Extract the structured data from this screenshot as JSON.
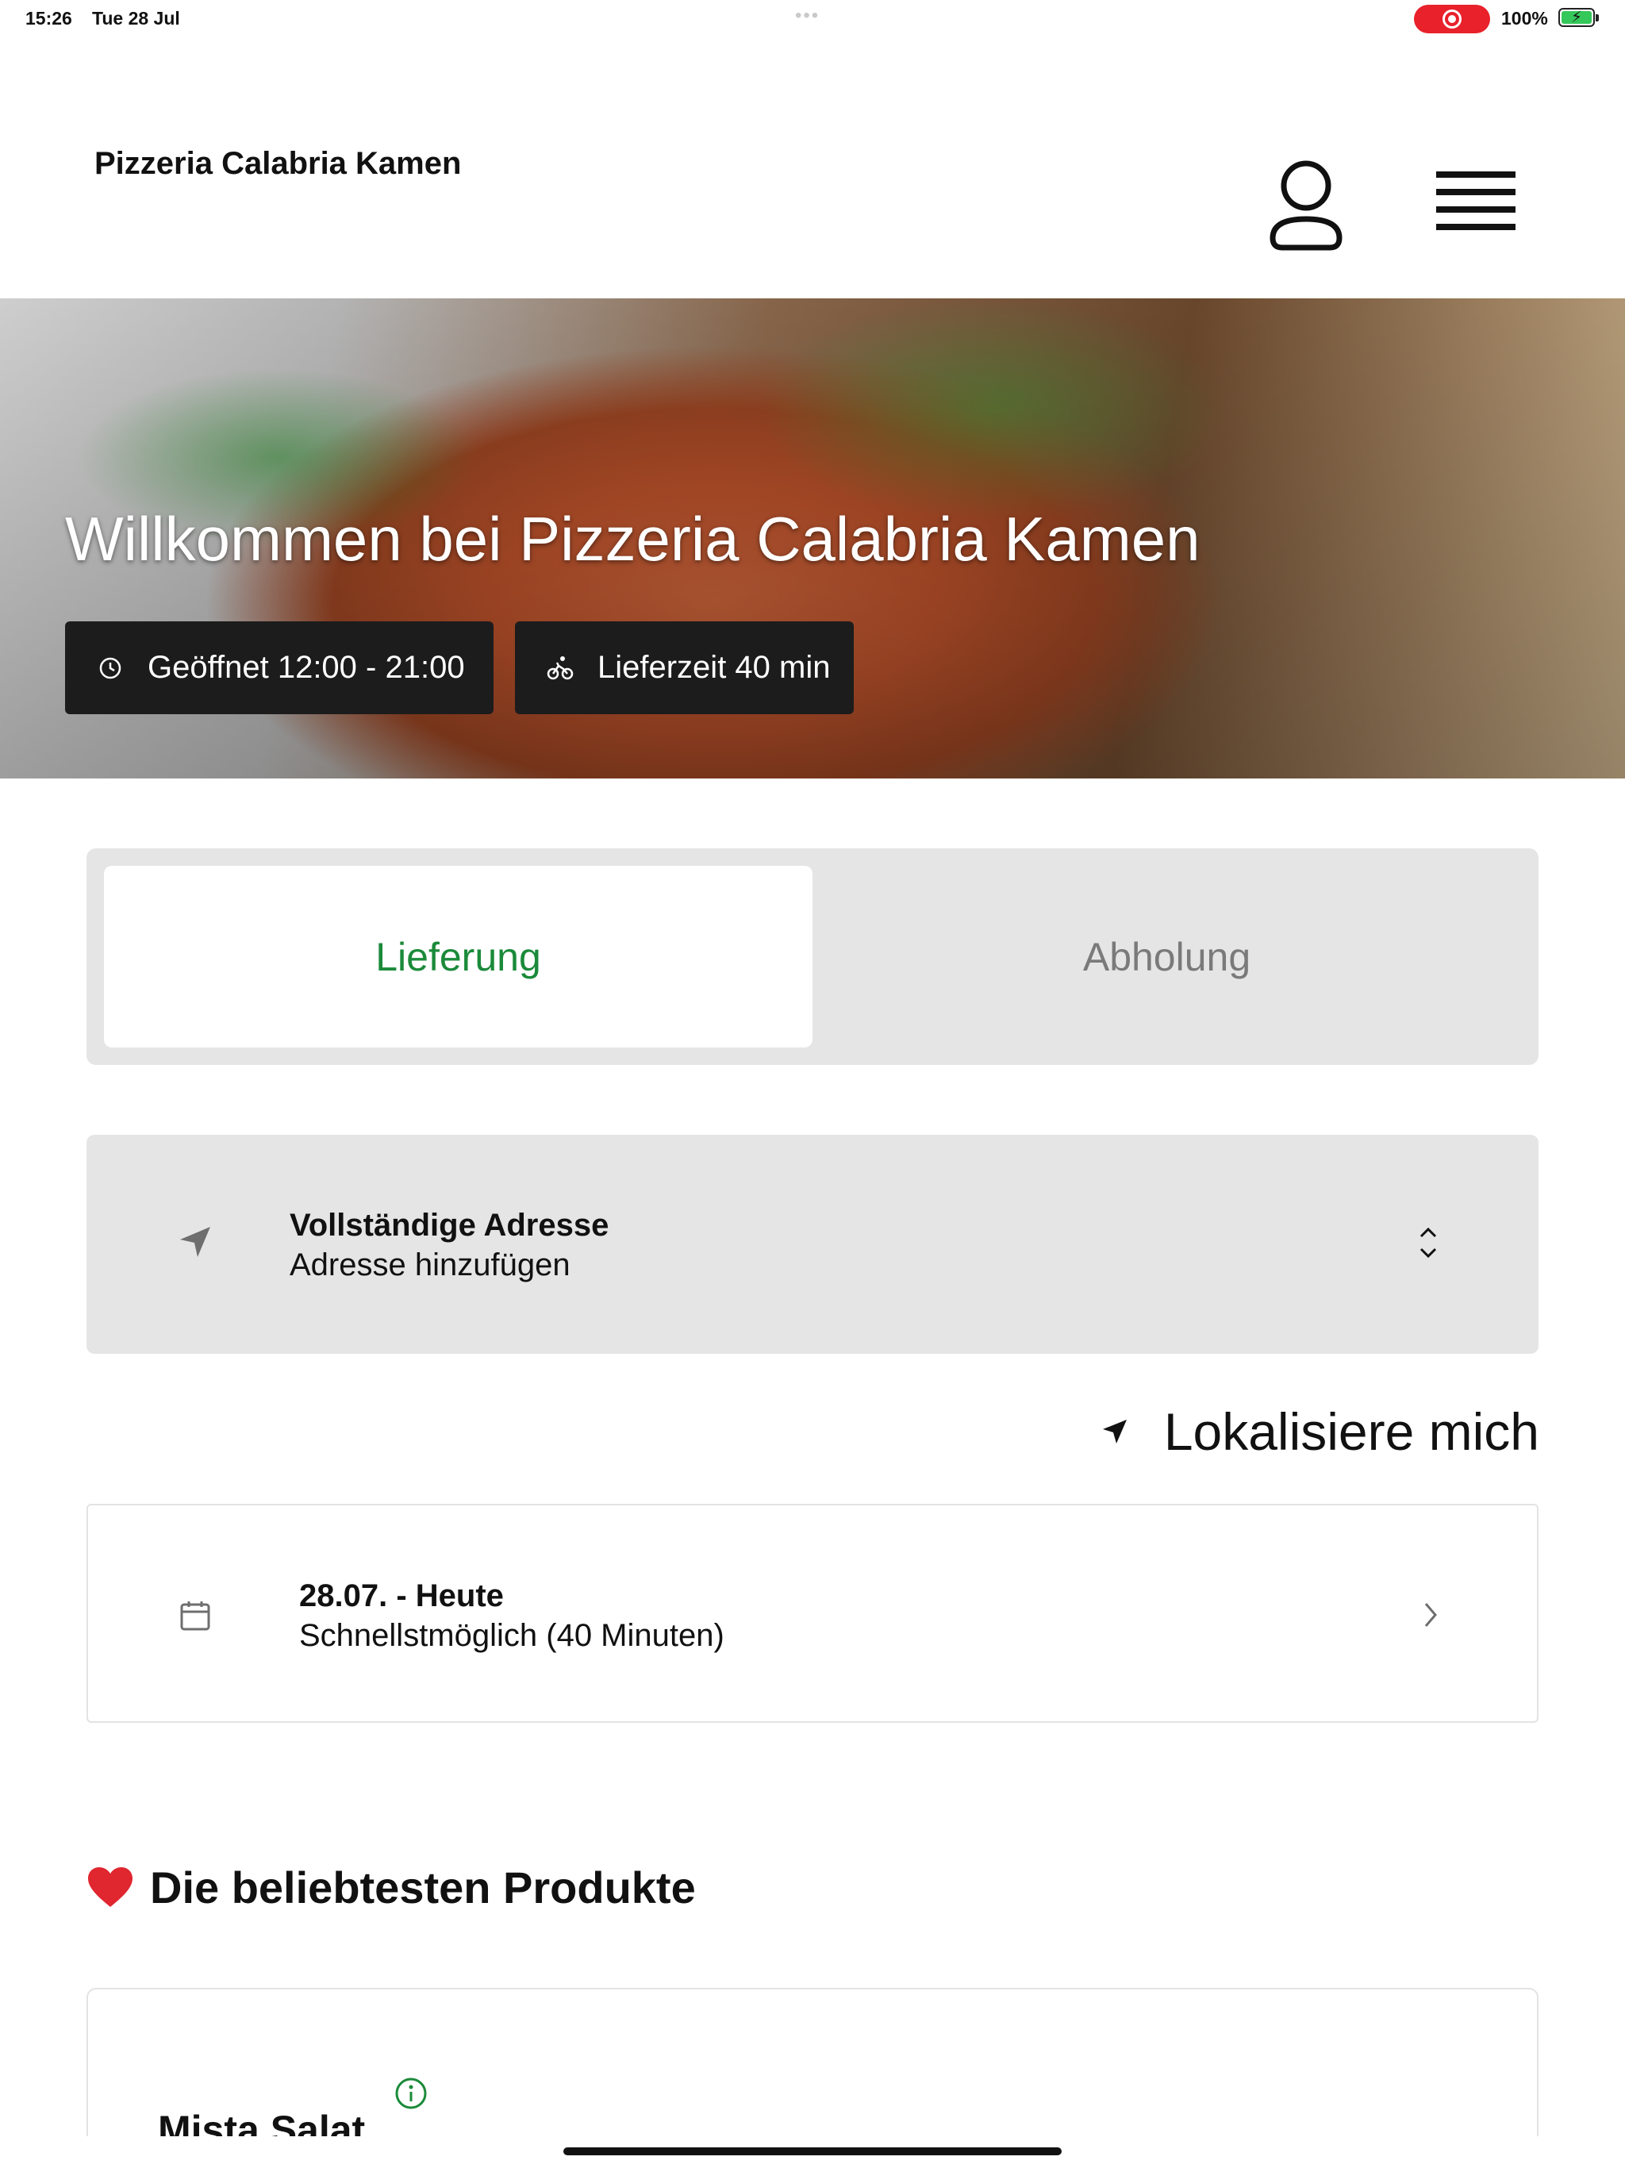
{
  "status_bar": {
    "time": "15:26",
    "date": "Tue 28 Jul",
    "battery": "100%",
    "recording_color": "#e8212b"
  },
  "header": {
    "brand": "Pizzeria Calabria Kamen",
    "profile_icon": "user-icon",
    "menu_icon": "hamburger-menu-icon"
  },
  "hero": {
    "title": "Willkommen bei Pizzeria Calabria Kamen",
    "opening_hours": "Geöffnet 12:00 - 21:00",
    "delivery_time": "Lieferzeit 40 min"
  },
  "order_mode": {
    "tabs": [
      {
        "label": "Lieferung",
        "active": true
      },
      {
        "label": "Abholung",
        "active": false
      }
    ],
    "active_color": "#1b8a3a"
  },
  "address": {
    "title": "Vollständige Adresse",
    "placeholder": "Adresse hinzufügen"
  },
  "locate": {
    "label": "Lokalisiere mich"
  },
  "schedule": {
    "date": "28.07. - Heute",
    "option": "Schnellstmöglich (40 Minuten)"
  },
  "popular": {
    "title": "Die beliebtesten Produkte",
    "products": [
      {
        "name": "Mista Salat"
      }
    ]
  }
}
